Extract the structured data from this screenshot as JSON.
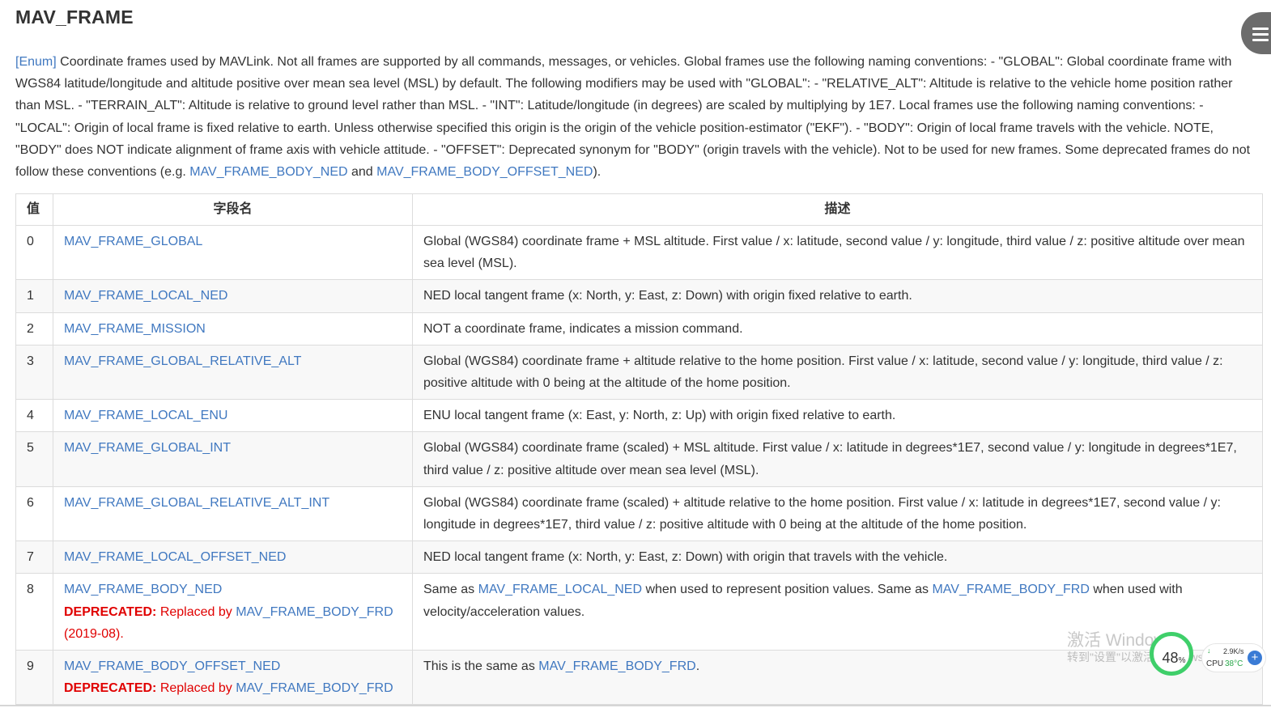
{
  "title": "MAV_FRAME",
  "intro": {
    "tag": "[Enum]",
    "text1": " Coordinate frames used by MAVLink. Not all frames are supported by all commands, messages, or vehicles. Global frames use the following naming conventions: - \"GLOBAL\": Global coordinate frame with WGS84 latitude/longitude and altitude positive over mean sea level (MSL) by default. The following modifiers may be used with \"GLOBAL\": - \"RELATIVE_ALT\": Altitude is relative to the vehicle home position rather than MSL. - \"TERRAIN_ALT\": Altitude is relative to ground level rather than MSL. - \"INT\": Latitude/longitude (in degrees) are scaled by multiplying by 1E7. Local frames use the following naming conventions: - \"LOCAL\": Origin of local frame is fixed relative to earth. Unless otherwise specified this origin is the origin of the vehicle position-estimator (\"EKF\"). - \"BODY\": Origin of local frame travels with the vehicle. NOTE, \"BODY\" does NOT indicate alignment of frame axis with vehicle attitude. - \"OFFSET\": Deprecated synonym for \"BODY\" (origin travels with the vehicle). Not to be used for new frames. Some deprecated frames do not follow these conventions (e.g. ",
    "link1": "MAV_FRAME_BODY_NED",
    "text2": " and ",
    "link2": "MAV_FRAME_BODY_OFFSET_NED",
    "text3": ")."
  },
  "table": {
    "headers": [
      "值",
      "字段名",
      "描述"
    ],
    "rows": [
      {
        "value": "0",
        "name": "MAV_FRAME_GLOBAL",
        "desc": "Global (WGS84) coordinate frame + MSL altitude. First value / x: latitude, second value / y: longitude, third value / z: positive altitude over mean sea level (MSL)."
      },
      {
        "value": "1",
        "name": "MAV_FRAME_LOCAL_NED",
        "desc": "NED local tangent frame (x: North, y: East, z: Down) with origin fixed relative to earth."
      },
      {
        "value": "2",
        "name": "MAV_FRAME_MISSION",
        "desc": "NOT a coordinate frame, indicates a mission command."
      },
      {
        "value": "3",
        "name": "MAV_FRAME_GLOBAL_RELATIVE_ALT",
        "desc": "Global (WGS84) coordinate frame + altitude relative to the home position. First value / x: latitude, second value / y: longitude, third value / z: positive altitude with 0 being at the altitude of the home position."
      },
      {
        "value": "4",
        "name": "MAV_FRAME_LOCAL_ENU",
        "desc": "ENU local tangent frame (x: East, y: North, z: Up) with origin fixed relative to earth."
      },
      {
        "value": "5",
        "name": "MAV_FRAME_GLOBAL_INT",
        "desc": "Global (WGS84) coordinate frame (scaled) + MSL altitude. First value / x: latitude in degrees*1E7, second value / y: longitude in degrees*1E7, third value / z: positive altitude over mean sea level (MSL)."
      },
      {
        "value": "6",
        "name": "MAV_FRAME_GLOBAL_RELATIVE_ALT_INT",
        "desc": "Global (WGS84) coordinate frame (scaled) + altitude relative to the home position. First value / x: latitude in degrees*1E7, second value / y: longitude in degrees*1E7, third value / z: positive altitude with 0 being at the altitude of the home position."
      },
      {
        "value": "7",
        "name": "MAV_FRAME_LOCAL_OFFSET_NED",
        "desc": "NED local tangent frame (x: North, y: East, z: Down) with origin that travels with the vehicle."
      }
    ],
    "row8": {
      "value": "8",
      "name": "MAV_FRAME_BODY_NED",
      "dep_label": "DEPRECATED:",
      "dep_text": " Replaced by ",
      "dep_link": "MAV_FRAME_BODY_FRD",
      "dep_date": "(2019-08).",
      "desc1": "Same as ",
      "desc_link1": "MAV_FRAME_LOCAL_NED",
      "desc2": " when used to represent position values. Same as ",
      "desc_link2": "MAV_FRAME_BODY_FRD",
      "desc3": " when used with velocity/acceleration values."
    },
    "row9": {
      "value": "9",
      "name": "MAV_FRAME_BODY_OFFSET_NED",
      "dep_label": "DEPRECATED:",
      "dep_text": " Replaced by ",
      "dep_link": "MAV_FRAME_BODY_FRD",
      "desc1": "This is the same as ",
      "desc_link": "MAV_FRAME_BODY_FRD",
      "desc2": "."
    }
  },
  "watermark": {
    "line1": "激活 Windows",
    "line2": "转到\"设置\"以激活 Windows。"
  },
  "widget": {
    "percent": "48",
    "percent_unit": "%",
    "speed": "2.9K/s",
    "cpu_label": "CPU",
    "cpu_temp": "38°C"
  },
  "colors": {
    "link": "#4078c0",
    "deprecated": "#e00000",
    "ring": "#3fcf6a"
  }
}
